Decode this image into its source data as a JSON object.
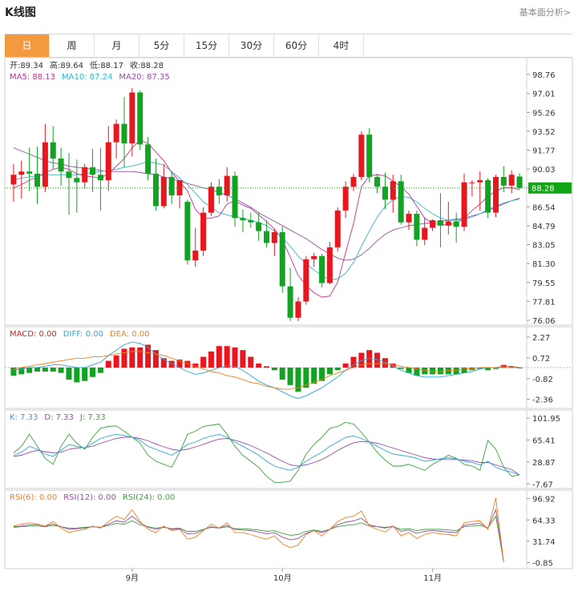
{
  "header": {
    "title": "K线图",
    "link": "基本面分析>"
  },
  "tabs": [
    "日",
    "周",
    "月",
    "5分",
    "15分",
    "30分",
    "60分",
    "4时"
  ],
  "active_tab": 0,
  "colors": {
    "up": "#e8171f",
    "down": "#13a322",
    "ma5": "#c1348d",
    "ma10": "#2fb7c9",
    "ma20": "#9a4ca8",
    "accent": "#f29a3f",
    "last": "#14a514",
    "diff": "#2aa7d6",
    "dea": "#f07f17",
    "k": "#2aa7d6",
    "d": "#9a4ca8",
    "j": "#3aa43a",
    "rsi6": "#f07f17",
    "rsi12": "#9a4ca8",
    "rsi24": "#3aa43a"
  },
  "legends": {
    "ohlc": [
      {
        "label": "开:",
        "value": "89.34",
        "color": "#333333"
      },
      {
        "label": "高:",
        "value": "89.64",
        "color": "#333333"
      },
      {
        "label": "低:",
        "value": "88.17",
        "color": "#333333"
      },
      {
        "label": "收:",
        "value": "88.28",
        "color": "#333333"
      }
    ],
    "ma": [
      {
        "label": "MA5: ",
        "value": "88.13",
        "color": "#c1348d"
      },
      {
        "label": "MA10: ",
        "value": "87.24",
        "color": "#2fb7c9"
      },
      {
        "label": "MA20: ",
        "value": "87.35",
        "color": "#9a4ca8"
      }
    ],
    "macd": [
      {
        "label": "MACD: ",
        "value": "0.00",
        "color": "#e8171f"
      },
      {
        "label": "DIFF: ",
        "value": "0.00",
        "color": "#2aa7d6"
      },
      {
        "label": "DEA: ",
        "value": "0.00",
        "color": "#f07f17"
      }
    ],
    "kdj": [
      {
        "label": "K: ",
        "value": "7.33",
        "color": "#2aa7d6"
      },
      {
        "label": "D: ",
        "value": "7.33",
        "color": "#9a4ca8"
      },
      {
        "label": "J: ",
        "value": "7.33",
        "color": "#3aa43a"
      }
    ],
    "rsi": [
      {
        "label": "RSI(6): ",
        "value": "0.00",
        "color": "#f07f17"
      },
      {
        "label": "RSI(12): ",
        "value": "0.00",
        "color": "#9a4ca8"
      },
      {
        "label": "RSI(24): ",
        "value": "0.00",
        "color": "#3aa43a"
      }
    ]
  },
  "chart_data": [
    {
      "type": "candlestick",
      "title": "K线图",
      "x_labels": [
        {
          "index": 15,
          "label": "9月"
        },
        {
          "index": 34,
          "label": "10月"
        },
        {
          "index": 53,
          "label": "11月"
        }
      ],
      "y_ticks": [
        "98.76",
        "97.01",
        "95.26",
        "93.52",
        "91.77",
        "90.03",
        "88.29",
        "86.54",
        "84.79",
        "83.05",
        "81.30",
        "79.55",
        "77.81",
        "76.06"
      ],
      "ylim": [
        76.06,
        98.76
      ],
      "last_price": "88.28",
      "ohlc": [
        [
          88.6,
          90.5,
          87.0,
          89.5
        ],
        [
          89.5,
          90.8,
          87.3,
          89.8
        ],
        [
          89.8,
          92.0,
          88.0,
          89.6
        ],
        [
          89.6,
          92.1,
          86.8,
          88.4
        ],
        [
          88.4,
          94.2,
          87.9,
          92.5
        ],
        [
          92.5,
          94.0,
          90.0,
          91.0
        ],
        [
          91.0,
          92.0,
          88.5,
          89.8
        ],
        [
          89.8,
          91.5,
          85.8,
          89.2
        ],
        [
          89.2,
          90.9,
          86.0,
          88.8
        ],
        [
          88.8,
          90.5,
          88.2,
          90.2
        ],
        [
          90.2,
          91.9,
          87.9,
          89.5
        ],
        [
          89.5,
          92.0,
          86.2,
          89.0
        ],
        [
          89.0,
          94.0,
          88.0,
          92.5
        ],
        [
          92.5,
          94.6,
          91.0,
          94.2
        ],
        [
          94.2,
          96.7,
          90.2,
          92.4
        ],
        [
          92.4,
          97.5,
          91.2,
          97.1
        ],
        [
          97.1,
          97.3,
          91.8,
          92.3
        ],
        [
          92.3,
          93.0,
          89.0,
          89.6
        ],
        [
          89.6,
          91.0,
          86.2,
          86.6
        ],
        [
          86.6,
          90.5,
          86.4,
          89.3
        ],
        [
          89.3,
          89.8,
          86.8,
          87.6
        ],
        [
          87.6,
          89.0,
          86.4,
          89.0
        ],
        [
          87.0,
          87.2,
          81.2,
          81.6
        ],
        [
          81.6,
          84.6,
          81.0,
          82.5
        ],
        [
          82.5,
          86.5,
          82.0,
          86.0
        ],
        [
          86.0,
          88.8,
          85.7,
          88.4
        ],
        [
          88.4,
          89.1,
          86.8,
          87.6
        ],
        [
          87.6,
          90.2,
          87.0,
          89.4
        ],
        [
          89.4,
          89.8,
          84.7,
          85.5
        ],
        [
          85.5,
          86.3,
          84.2,
          85.3
        ],
        [
          85.3,
          86.0,
          84.6,
          85.1
        ],
        [
          85.1,
          86.0,
          83.4,
          84.3
        ],
        [
          84.3,
          85.3,
          82.8,
          83.2
        ],
        [
          83.2,
          84.5,
          82.0,
          84.2
        ],
        [
          84.2,
          84.7,
          78.6,
          79.2
        ],
        [
          79.2,
          80.9,
          76.0,
          76.3
        ],
        [
          76.3,
          78.2,
          76.0,
          77.8
        ],
        [
          77.8,
          82.0,
          77.5,
          81.7
        ],
        [
          81.7,
          82.3,
          81.0,
          82.0
        ],
        [
          82.0,
          82.2,
          79.1,
          79.5
        ],
        [
          79.5,
          83.3,
          79.4,
          82.8
        ],
        [
          82.8,
          86.5,
          82.4,
          86.2
        ],
        [
          86.2,
          88.9,
          85.5,
          88.4
        ],
        [
          88.4,
          89.6,
          88.0,
          89.3
        ],
        [
          89.3,
          93.5,
          89.0,
          93.2
        ],
        [
          93.2,
          93.8,
          88.8,
          89.3
        ],
        [
          89.3,
          89.6,
          87.8,
          88.4
        ],
        [
          88.4,
          89.7,
          86.3,
          87.2
        ],
        [
          87.2,
          89.5,
          86.0,
          88.9
        ],
        [
          88.9,
          89.5,
          84.9,
          85.1
        ],
        [
          85.1,
          86.2,
          84.4,
          85.9
        ],
        [
          85.9,
          86.2,
          82.9,
          83.5
        ],
        [
          83.5,
          85.5,
          83.0,
          84.6
        ],
        [
          84.6,
          85.4,
          84.3,
          85.3
        ],
        [
          85.3,
          87.8,
          82.8,
          84.8
        ],
        [
          84.8,
          87.0,
          84.0,
          85.2
        ],
        [
          85.2,
          86.0,
          83.2,
          84.7
        ],
        [
          84.7,
          89.6,
          84.3,
          88.8
        ],
        [
          88.8,
          89.0,
          87.5,
          88.8
        ],
        [
          88.8,
          89.8,
          86.2,
          89.0
        ],
        [
          89.0,
          89.2,
          85.5,
          86.0
        ],
        [
          86.0,
          89.5,
          85.6,
          89.3
        ],
        [
          89.3,
          90.3,
          87.9,
          88.5
        ],
        [
          88.5,
          89.9,
          87.8,
          89.5
        ],
        [
          89.34,
          89.64,
          88.17,
          88.28
        ]
      ],
      "ma5": [
        88.3,
        88.6,
        89.0,
        89.3,
        89.7,
        90.0,
        90.2,
        90.0,
        89.6,
        89.4,
        89.3,
        89.2,
        89.6,
        90.3,
        91.0,
        92.0,
        92.7,
        92.4,
        91.6,
        90.8,
        89.7,
        88.9,
        88.0,
        86.3,
        85.5,
        85.5,
        85.7,
        86.8,
        87.1,
        86.7,
        86.4,
        85.8,
        85.2,
        84.5,
        83.5,
        81.9,
        80.2,
        79.3,
        78.6,
        78.2,
        78.3,
        79.6,
        82.3,
        85.0,
        88.4,
        89.4,
        89.5,
        89.4,
        88.9,
        88.4,
        87.7,
        86.6,
        85.5,
        85.0,
        84.9,
        84.9,
        85.0,
        85.5,
        86.2,
        86.8,
        87.5,
        88.0,
        88.3,
        88.3,
        88.13
      ],
      "ma10": [
        89.0,
        89.2,
        89.3,
        89.4,
        89.5,
        89.5,
        89.5,
        89.5,
        89.5,
        89.6,
        89.7,
        89.8,
        89.9,
        90.0,
        90.2,
        90.3,
        90.5,
        90.7,
        90.6,
        90.4,
        89.8,
        89.2,
        88.6,
        87.8,
        87.0,
        86.5,
        86.0,
        85.8,
        85.6,
        85.5,
        85.3,
        85.1,
        84.8,
        84.3,
        83.7,
        82.9,
        82.0,
        81.3,
        80.7,
        80.2,
        79.8,
        79.9,
        80.4,
        81.4,
        82.9,
        84.3,
        85.6,
        86.6,
        87.2,
        87.5,
        87.4,
        87.0,
        86.4,
        85.9,
        85.5,
        85.3,
        85.3,
        85.4,
        85.6,
        85.9,
        86.3,
        86.6,
        86.9,
        87.1,
        87.24
      ],
      "ma20": [
        92.0,
        91.7,
        91.4,
        91.1,
        90.8,
        90.6,
        90.5,
        90.3,
        90.2,
        90.1,
        90.0,
        89.9,
        89.8,
        89.8,
        89.8,
        89.8,
        89.7,
        89.6,
        89.5,
        89.3,
        89.1,
        88.9,
        88.7,
        88.5,
        88.3,
        88.1,
        87.9,
        87.6,
        87.3,
        86.9,
        86.5,
        86.0,
        85.6,
        85.2,
        84.8,
        84.4,
        84.0,
        83.6,
        83.1,
        82.6,
        82.2,
        81.8,
        81.6,
        81.7,
        82.1,
        82.7,
        83.4,
        84.0,
        84.4,
        84.6,
        84.8,
        84.9,
        85.0,
        85.1,
        85.2,
        85.3,
        85.4,
        85.5,
        85.7,
        85.9,
        86.2,
        86.5,
        86.8,
        87.1,
        87.35
      ]
    },
    {
      "type": "bar",
      "title": "MACD",
      "y_ticks": [
        "2.27",
        "0.72",
        "-0.82",
        "-2.36"
      ],
      "ylim": [
        -2.8,
        2.8
      ],
      "macd": [
        -0.6,
        -0.5,
        -0.4,
        -0.3,
        -0.3,
        -0.3,
        -0.4,
        -0.9,
        -1.1,
        -1.0,
        -0.7,
        -0.4,
        0.5,
        0.9,
        1.4,
        1.5,
        1.5,
        1.7,
        1.3,
        0.7,
        0.5,
        0.6,
        0.5,
        0.3,
        0.8,
        1.2,
        1.6,
        1.6,
        1.5,
        1.3,
        0.8,
        0.3,
        0.1,
        -0.2,
        -0.9,
        -1.3,
        -1.8,
        -1.5,
        -1.2,
        -1.0,
        -0.5,
        -0.2,
        0.3,
        0.8,
        1.1,
        1.3,
        1.1,
        0.7,
        0.3,
        -0.1,
        -0.4,
        -0.6,
        -0.5,
        -0.5,
        -0.5,
        -0.5,
        -0.5,
        -0.4,
        -0.2,
        -0.1,
        -0.2,
        -0.1,
        0.2,
        0.1,
        0.0
      ],
      "diff": [
        -0.2,
        -0.1,
        0.0,
        0.0,
        0.1,
        0.2,
        0.2,
        0.1,
        0.0,
        0.0,
        0.2,
        0.4,
        0.9,
        1.3,
        1.7,
        1.9,
        1.8,
        1.5,
        1.0,
        0.6,
        0.3,
        0.0,
        -0.3,
        -0.5,
        -0.4,
        -0.2,
        0.0,
        0.1,
        0.1,
        -0.2,
        -0.6,
        -1.0,
        -1.3,
        -1.5,
        -1.8,
        -2.1,
        -2.3,
        -2.1,
        -1.8,
        -1.5,
        -1.1,
        -0.7,
        -0.2,
        0.2,
        0.5,
        0.7,
        0.6,
        0.4,
        0.1,
        -0.2,
        -0.4,
        -0.6,
        -0.7,
        -0.7,
        -0.7,
        -0.6,
        -0.5,
        -0.4,
        -0.3,
        -0.1,
        0.0,
        0.0,
        0.1,
        0.1,
        0.0
      ],
      "dea": [
        -0.1,
        0.0,
        0.1,
        0.2,
        0.3,
        0.4,
        0.5,
        0.6,
        0.7,
        0.7,
        0.8,
        0.8,
        0.9,
        1.0,
        1.1,
        1.2,
        1.2,
        1.1,
        1.0,
        0.9,
        0.7,
        0.5,
        0.3,
        0.1,
        -0.1,
        -0.3,
        -0.4,
        -0.6,
        -0.7,
        -0.9,
        -1.1,
        -1.2,
        -1.4,
        -1.5,
        -1.6,
        -1.6,
        -1.5,
        -1.3,
        -1.1,
        -0.9,
        -0.6,
        -0.4,
        -0.2,
        0.0,
        0.2,
        0.3,
        0.3,
        0.3,
        0.2,
        0.1,
        0.0,
        -0.1,
        -0.2,
        -0.3,
        -0.3,
        -0.2,
        -0.2,
        -0.1,
        -0.1,
        0.0,
        0.0,
        0.0,
        0.0,
        0.0,
        0.0
      ]
    },
    {
      "type": "line",
      "title": "KDJ",
      "y_ticks": [
        "101.95",
        "65.41",
        "28.87",
        "-7.67"
      ],
      "ylim": [
        -10,
        110
      ],
      "k": [
        40,
        45,
        55,
        50,
        42,
        38,
        48,
        58,
        55,
        52,
        60,
        68,
        72,
        75,
        73,
        70,
        65,
        55,
        50,
        45,
        40,
        48,
        58,
        62,
        68,
        72,
        75,
        70,
        62,
        55,
        48,
        40,
        30,
        22,
        18,
        15,
        20,
        30,
        38,
        45,
        55,
        62,
        70,
        72,
        68,
        62,
        55,
        48,
        42,
        40,
        38,
        35,
        30,
        32,
        34,
        36,
        34,
        30,
        28,
        24,
        30,
        20,
        15,
        12,
        7.33
      ],
      "d": [
        38,
        40,
        45,
        48,
        46,
        44,
        45,
        50,
        52,
        53,
        55,
        60,
        64,
        68,
        70,
        70,
        68,
        64,
        59,
        54,
        50,
        48,
        50,
        54,
        58,
        63,
        67,
        68,
        65,
        61,
        56,
        50,
        44,
        37,
        30,
        24,
        22,
        24,
        28,
        33,
        40,
        48,
        55,
        61,
        63,
        62,
        60,
        56,
        52,
        48,
        44,
        40,
        36,
        34,
        33,
        33,
        33,
        32,
        31,
        28,
        28,
        24,
        20,
        16,
        7.33
      ],
      "j": [
        44,
        55,
        75,
        55,
        35,
        25,
        55,
        75,
        60,
        50,
        70,
        85,
        88,
        89,
        80,
        70,
        60,
        40,
        30,
        25,
        20,
        45,
        75,
        80,
        88,
        90,
        92,
        75,
        55,
        40,
        30,
        20,
        5,
        -5,
        -5,
        -3,
        15,
        42,
        58,
        70,
        85,
        88,
        95,
        92,
        78,
        62,
        45,
        32,
        22,
        22,
        25,
        20,
        15,
        25,
        32,
        40,
        35,
        25,
        22,
        15,
        65,
        50,
        20,
        5,
        7.33
      ]
    },
    {
      "type": "line",
      "title": "RSI",
      "y_ticks": [
        "96.92",
        "64.33",
        "31.74",
        "-0.85"
      ],
      "ylim": [
        -5,
        105
      ],
      "rsi6": [
        55,
        58,
        60,
        58,
        55,
        62,
        52,
        45,
        48,
        50,
        55,
        52,
        62,
        70,
        65,
        80,
        62,
        50,
        45,
        55,
        48,
        50,
        35,
        38,
        48,
        58,
        52,
        60,
        45,
        45,
        42,
        38,
        35,
        40,
        28,
        22,
        26,
        42,
        48,
        40,
        50,
        62,
        68,
        70,
        78,
        55,
        50,
        46,
        55,
        40,
        45,
        36,
        42,
        45,
        43,
        42,
        40,
        60,
        62,
        63,
        50,
        98,
        0.0
      ],
      "rsi12": [
        54,
        55,
        57,
        57,
        55,
        58,
        54,
        50,
        51,
        52,
        54,
        53,
        58,
        63,
        61,
        70,
        60,
        53,
        50,
        54,
        50,
        51,
        43,
        44,
        49,
        54,
        52,
        56,
        50,
        49,
        48,
        46,
        43,
        45,
        38,
        34,
        36,
        44,
        48,
        45,
        50,
        57,
        61,
        63,
        67,
        57,
        54,
        52,
        55,
        47,
        49,
        44,
        47,
        48,
        47,
        46,
        45,
        56,
        58,
        59,
        52,
        80,
        0.0
      ],
      "rsi24": [
        53,
        54,
        55,
        55,
        54,
        56,
        54,
        52,
        52,
        53,
        54,
        53,
        56,
        59,
        58,
        63,
        57,
        54,
        52,
        53,
        51,
        52,
        47,
        47,
        50,
        53,
        52,
        54,
        51,
        51,
        50,
        49,
        47,
        48,
        44,
        41,
        42,
        47,
        49,
        47,
        50,
        54,
        56,
        57,
        60,
        55,
        54,
        53,
        54,
        50,
        51,
        48,
        50,
        50,
        50,
        49,
        48,
        54,
        55,
        56,
        52,
        70,
        0.0
      ]
    }
  ]
}
